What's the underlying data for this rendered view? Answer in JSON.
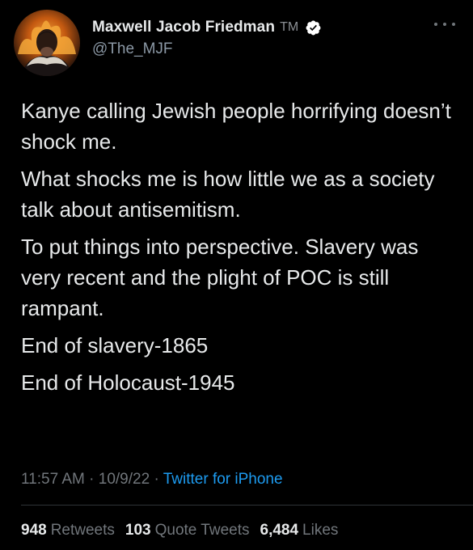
{
  "author": {
    "display_name": "Maxwell Jacob Friedman",
    "trademark": "TM",
    "handle": "@The_MJF",
    "verified": true,
    "avatar": "profile-photo"
  },
  "menu": {
    "icon": "more-horizontal-icon"
  },
  "tweet": {
    "paragraphs": [
      "Kanye calling Jewish people horrifying doesn’t shock me.",
      "What shocks me is how little we as a society talk about antisemitism.",
      "To put things into perspective. Slavery was very recent and the plight of POC is still rampant.",
      "End of slavery-1865",
      "End of Holocaust-1945"
    ]
  },
  "meta": {
    "time": "11:57 AM",
    "separator": " · ",
    "date": "10/9/22",
    "source": "Twitter for iPhone"
  },
  "stats": {
    "retweets_count": "948",
    "retweets_label": "Retweets",
    "quotes_count": "103",
    "quotes_label": "Quote Tweets",
    "likes_count": "6,484",
    "likes_label": "Likes"
  },
  "colors": {
    "background": "#000000",
    "text": "#E7E9EA",
    "secondary": "#71767B",
    "link": "#1D9BF0",
    "verified": "#1D9BF0"
  }
}
